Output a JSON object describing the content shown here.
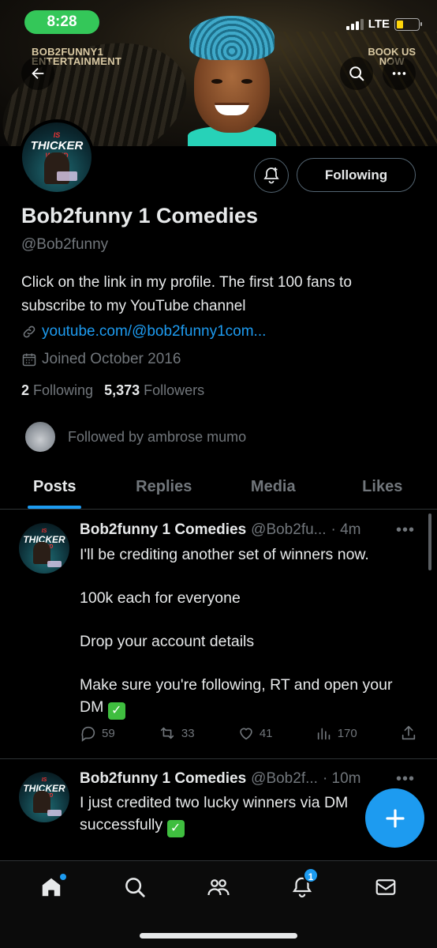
{
  "status_bar": {
    "time": "8:28",
    "network": "LTE",
    "battery_level": 0.3
  },
  "banner": {
    "brand_line1": "BOB2FUNNY1",
    "brand_line2": "ENTERTAINMENT",
    "book_line1": "BOOK US",
    "book_line2": "NOW"
  },
  "profile": {
    "avatar_text_top": "IS",
    "avatar_text_main": "THICKER",
    "avatar_text_sub": "WITED",
    "name": "Bob2funny 1 Comedies",
    "handle": "@Bob2funny",
    "bio": "Click on the link in my profile. The first 100 fans to subscribe to my YouTube channel",
    "link": "youtube.com/@bob2funny1com...",
    "joined": "Joined October 2016",
    "following_count": "2",
    "following_label": "Following",
    "followers_count": "5,373",
    "followers_label": "Followers",
    "followed_by": "Followed by ambrose mumo",
    "following_button": "Following"
  },
  "tabs": [
    {
      "label": "Posts",
      "active": true
    },
    {
      "label": "Replies",
      "active": false
    },
    {
      "label": "Media",
      "active": false
    },
    {
      "label": "Likes",
      "active": false
    }
  ],
  "posts": [
    {
      "name": "Bob2funny 1 Comedies",
      "handle": "@Bob2fu...",
      "time": "· 4m",
      "lines": [
        "I'll be crediting another set of winners now.",
        "100k each for everyone",
        "Drop your account details",
        "Make sure you're following, RT and open your DM"
      ],
      "replies": "59",
      "reposts": "33",
      "likes": "41",
      "views": "170"
    },
    {
      "name": "Bob2funny 1 Comedies",
      "handle": "@Bob2f...",
      "time": "· 10m",
      "lines": [
        "I just credited two lucky winners via DM successfully"
      ]
    }
  ],
  "notifications_badge": "1",
  "colors": {
    "accent": "#1d9bf0",
    "background": "#000000",
    "muted": "#71767b",
    "time_pill": "#34c759"
  }
}
